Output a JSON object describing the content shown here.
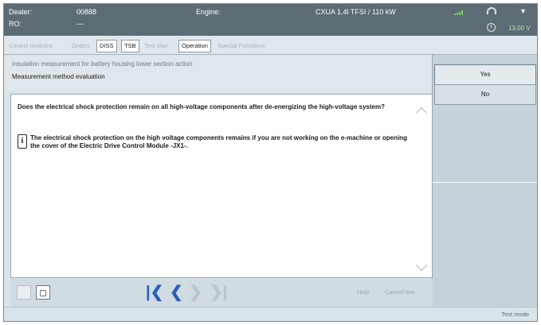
{
  "header": {
    "dealer_label": "Dealer:",
    "dealer_value": "00888",
    "ro_label": "RO:",
    "ro_value": "---",
    "engine_label": "Engine:",
    "engine_value": "CXUA 1.4l TFSI / 110 kW",
    "voltage": "13.00 V"
  },
  "tabs": [
    "Control modules",
    "Orders",
    "DISS",
    "TSB",
    "Test plan",
    "Operation",
    "Special Functions"
  ],
  "info": {
    "title": "Insulation measurement for battery housing lower section action",
    "subtitle": "Measurement method evaluation"
  },
  "content": {
    "question": "Does the electrical shock protection remain on all high-voltage components after de-energizing the high-voltage system?",
    "note_icon": "info-icon",
    "note": "The electrical shock protection on the high voltage components remains if you are not working on the e-machine or opening the cover of the Electric Drive Control Module -JX1-."
  },
  "answers": {
    "yes": "Yes",
    "no": "No"
  },
  "toolbar": {
    "help": "Help",
    "cancel_test": "Cancel test"
  },
  "status": {
    "text": "Test mode"
  }
}
